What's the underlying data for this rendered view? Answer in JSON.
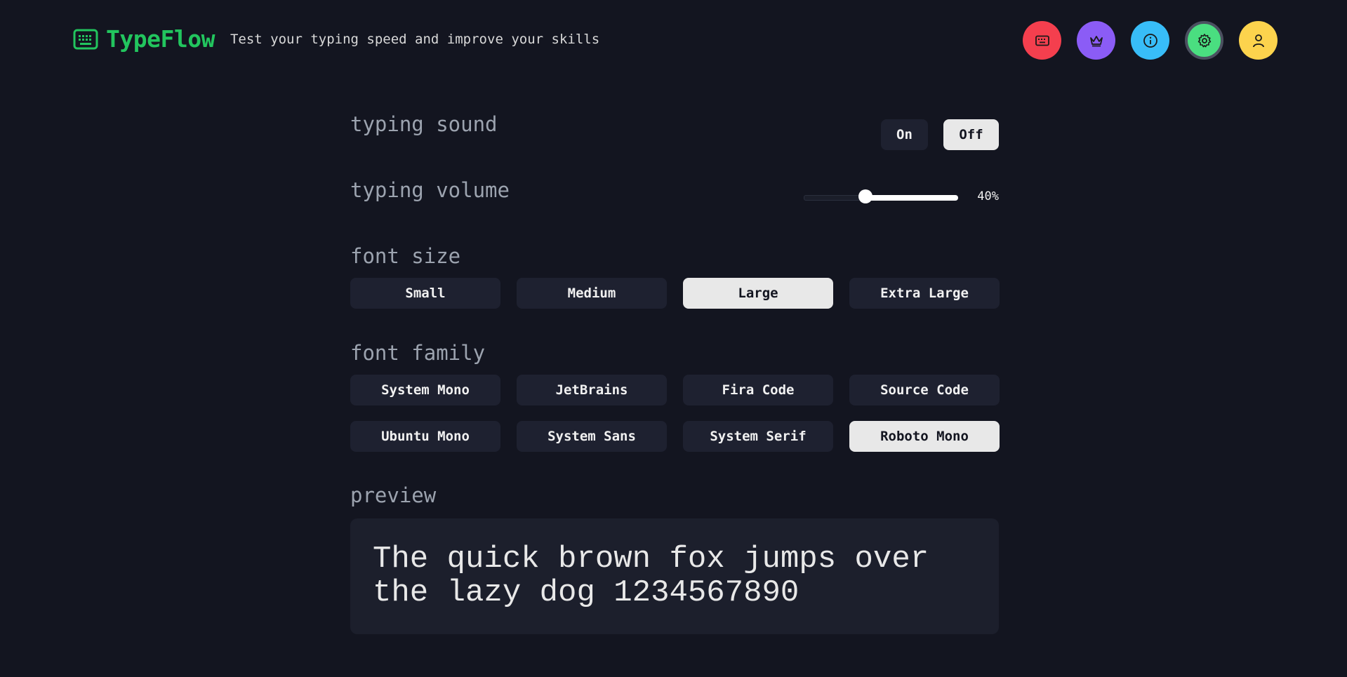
{
  "app": {
    "title": "TypeFlow",
    "tagline": "Test your typing speed and improve your skills",
    "brand_color": "#22c55e",
    "brand_icon": "keyboard-icon"
  },
  "nav": [
    {
      "name": "typing-test",
      "icon": "keyboard-icon",
      "color": "#f43f4e",
      "active": false
    },
    {
      "name": "leaderboard",
      "icon": "crown-icon",
      "color": "#8b5cf6",
      "active": false
    },
    {
      "name": "about",
      "icon": "info-icon",
      "color": "#38bdf8",
      "active": false
    },
    {
      "name": "settings",
      "icon": "gear-icon",
      "color": "#4ade80",
      "active": true
    },
    {
      "name": "profile",
      "icon": "user-icon",
      "color": "#fcd34d",
      "active": false
    }
  ],
  "settings": {
    "typing_sound": {
      "label": "typing sound",
      "options": [
        "On",
        "Off"
      ],
      "selected": "Off"
    },
    "typing_volume": {
      "label": "typing volume",
      "value": 40,
      "display": "40%"
    },
    "font_size": {
      "label": "font size",
      "options": [
        "Small",
        "Medium",
        "Large",
        "Extra Large"
      ],
      "selected": "Large"
    },
    "font_family": {
      "label": "font family",
      "options": [
        "System Mono",
        "JetBrains",
        "Fira Code",
        "Source Code",
        "Ubuntu Mono",
        "System Sans",
        "System Serif",
        "Roboto Mono"
      ],
      "selected": "Roboto Mono"
    },
    "preview": {
      "label": "preview",
      "text": "The quick brown fox jumps over the lazy dog 1234567890"
    }
  },
  "colors": {
    "background": "#131520",
    "button": "#1e2130",
    "selected_button": "#e8e8e8",
    "label": "#9ca3af"
  }
}
